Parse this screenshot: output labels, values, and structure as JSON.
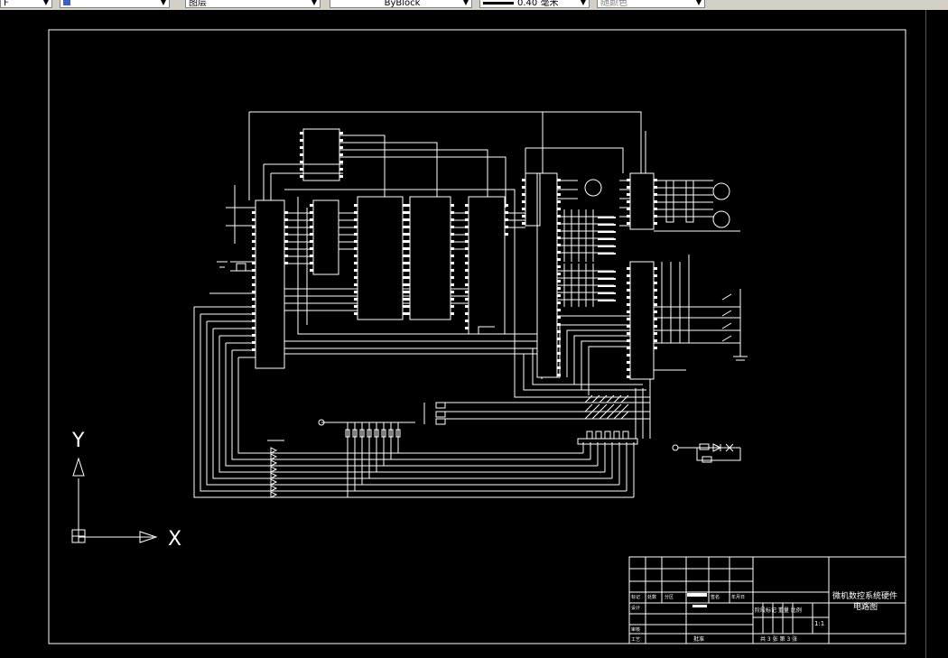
{
  "toolbar": {
    "items": [
      {
        "value": "F",
        "name": "layer-dropdown"
      },
      {
        "value": "",
        "name": "color-dropdown"
      },
      {
        "value": "图层",
        "name": "linetype-group-dropdown"
      },
      {
        "value": "ByBlock",
        "name": "linetype-dropdown"
      },
      {
        "value": "0.40 毫米",
        "name": "lineweight-dropdown"
      },
      {
        "value": "随颜色",
        "name": "plotstyle-dropdown"
      }
    ]
  },
  "ucs": {
    "x_label": "X",
    "y_label": "Y"
  },
  "title_block": {
    "drawing_title_line1": "微机数控系统硬件",
    "drawing_title_line2": "电路图",
    "scale": "1:1",
    "sheet_info": "共 3 张 第 3 张",
    "approved_label": "批准",
    "stage_headers": "阶段标记 重量 比例",
    "rev_headers": [
      "标记",
      "处数",
      "分区",
      "更改文件号",
      "签名",
      "年月日"
    ],
    "row_labels": [
      "设计",
      "审核",
      "工艺"
    ]
  },
  "colors": {
    "background": "#000000",
    "lines": "#ffffff",
    "toolbar": "#d4d0c8"
  }
}
